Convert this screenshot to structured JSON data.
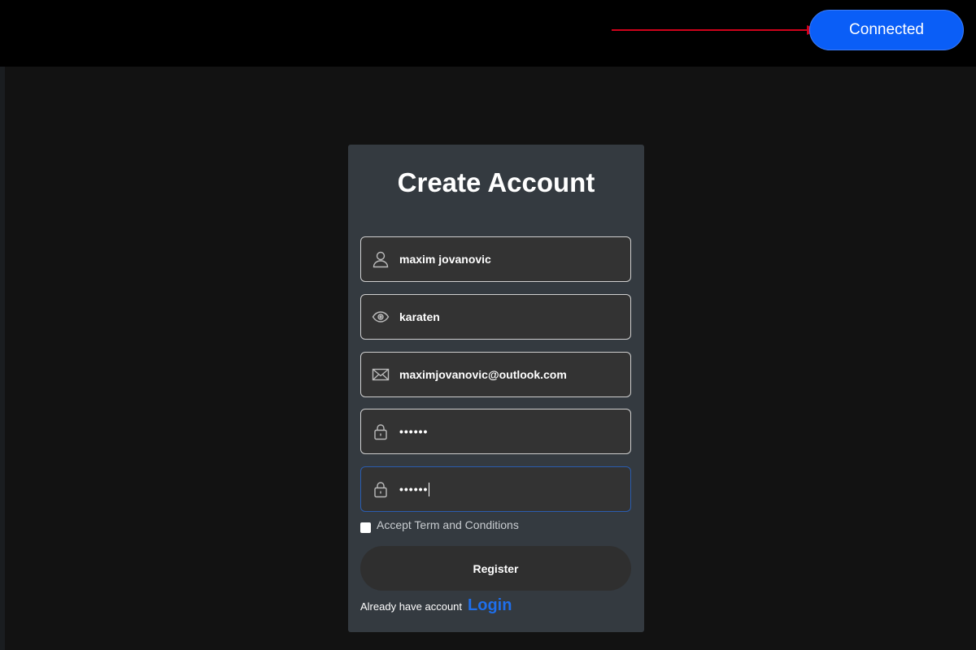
{
  "header": {
    "status_button_label": "Connected",
    "accent_color": "#0a5ef7",
    "pointer_arrow_color": "#d0021b"
  },
  "form": {
    "title": "Create Account",
    "fields": [
      {
        "name": "username",
        "icon": "user-icon",
        "value": "maxim jovanovic"
      },
      {
        "name": "name",
        "icon": "eye-icon",
        "value": "karaten"
      },
      {
        "name": "email",
        "icon": "envelope-icon",
        "value": "maximjovanovic@outlook.com"
      },
      {
        "name": "password",
        "icon": "lock-icon",
        "value": "••••••"
      },
      {
        "name": "confirm-password",
        "icon": "lock-icon",
        "value": "••••••"
      }
    ],
    "terms_label": "Accept Term and Conditions",
    "terms_checked": false,
    "register_label": "Register",
    "login_prompt": "Already have account",
    "login_link": "Login",
    "link_color": "#1f6feb"
  }
}
